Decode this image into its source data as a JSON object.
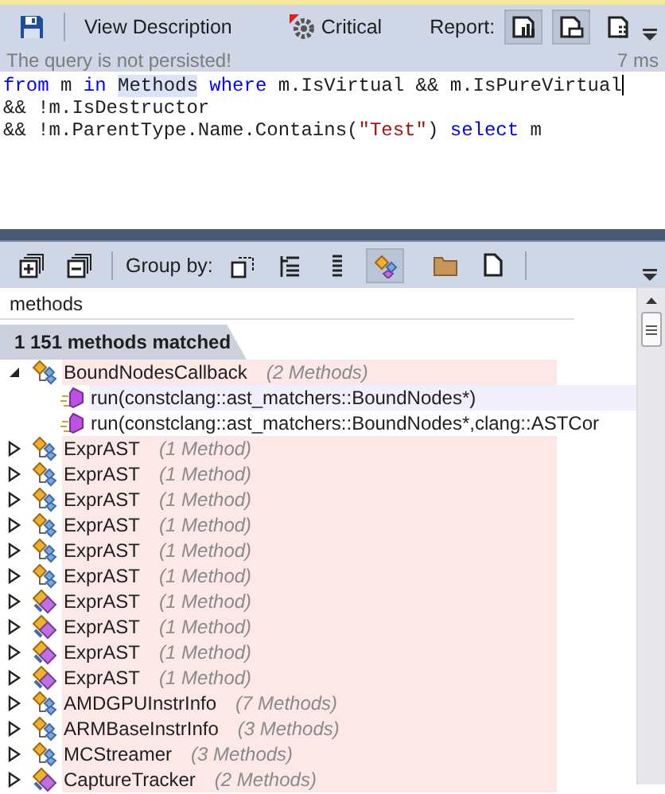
{
  "toolbar": {
    "view_description": "View Description",
    "critical": "Critical",
    "report_label": "Report:",
    "report_buttons": [
      {
        "on": true
      },
      {
        "on": true
      },
      {
        "on": false
      }
    ]
  },
  "status": {
    "message": "The query is not persisted!",
    "duration": "7 ms"
  },
  "query_lines": [
    [
      {
        "kind": "keyword",
        "text": "from"
      },
      {
        "kind": "plain",
        "text": " m "
      },
      {
        "kind": "keyword",
        "text": "in "
      },
      {
        "kind": "highlight",
        "text": "Methods"
      },
      {
        "kind": "keyword",
        "text": " where"
      },
      {
        "kind": "plain",
        "text": " m.IsVirtual && m.IsPureVirtual"
      }
    ],
    [
      {
        "kind": "plain",
        "text": "&& !m.IsDestructor"
      }
    ],
    [
      {
        "kind": "plain",
        "text": "&& !m.ParentType.Name.Contains("
      },
      {
        "kind": "string",
        "text": "\"Test\""
      },
      {
        "kind": "plain",
        "text": ") "
      },
      {
        "kind": "keyword",
        "text": "select"
      },
      {
        "kind": "plain",
        "text": " m"
      }
    ]
  ],
  "results_toolbar": {
    "group_by_label": "Group by:",
    "group_buttons": [
      {
        "on": false
      },
      {
        "on": false
      },
      {
        "on": false
      },
      {
        "on": true
      }
    ]
  },
  "search": {
    "value": "methods"
  },
  "results_header": "1 151 methods matched",
  "tree": [
    {
      "kind": "class",
      "name": "BoundNodesCallback",
      "count": "(2 Methods)",
      "expanded": true,
      "children": [
        {
          "name": "run(constclang::ast_matchers::BoundNodes*)",
          "selected": true
        },
        {
          "name": "run(constclang::ast_matchers::BoundNodes*,clang::ASTCor",
          "selected": false
        }
      ]
    },
    {
      "kind": "class",
      "name": "ExprAST",
      "count": "(1 Method)",
      "expanded": false
    },
    {
      "kind": "class",
      "name": "ExprAST",
      "count": "(1 Method)",
      "expanded": false
    },
    {
      "kind": "class",
      "name": "ExprAST",
      "count": "(1 Method)",
      "expanded": false
    },
    {
      "kind": "class",
      "name": "ExprAST",
      "count": "(1 Method)",
      "expanded": false
    },
    {
      "kind": "class",
      "name": "ExprAST",
      "count": "(1 Method)",
      "expanded": false
    },
    {
      "kind": "class",
      "name": "ExprAST",
      "count": "(1 Method)",
      "expanded": false
    },
    {
      "kind": "interface",
      "name": "ExprAST",
      "count": "(1 Method)",
      "expanded": false
    },
    {
      "kind": "interface",
      "name": "ExprAST",
      "count": "(1 Method)",
      "expanded": false
    },
    {
      "kind": "interface",
      "name": "ExprAST",
      "count": "(1 Method)",
      "expanded": false
    },
    {
      "kind": "interface",
      "name": "ExprAST",
      "count": "(1 Method)",
      "expanded": false
    },
    {
      "kind": "class",
      "name": "AMDGPUInstrInfo",
      "count": "(7 Methods)",
      "expanded": false
    },
    {
      "kind": "class",
      "name": "ARMBaseInstrInfo",
      "count": "(3 Methods)",
      "expanded": false
    },
    {
      "kind": "class",
      "name": "MCStreamer",
      "count": "(3 Methods)",
      "expanded": false
    },
    {
      "kind": "interface",
      "name": "CaptureTracker",
      "count": "(2 Methods)",
      "expanded": false
    }
  ]
}
